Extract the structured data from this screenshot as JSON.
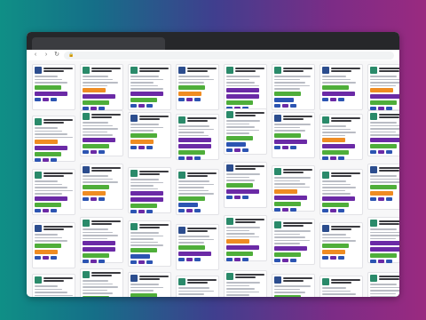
{
  "browser": {
    "tab_title": "",
    "url": ""
  },
  "board": {
    "card_text": "",
    "tag_text": ""
  },
  "colors": {
    "tag_green": "#4fae3a",
    "tag_purple": "#6b2aa6",
    "tag_orange": "#ef8c22",
    "tag_blue": "#2c54b2",
    "thumb_green": "#2a8a6a",
    "thumb_blue": "#2c4d8e"
  },
  "icons": {
    "back": "back-icon",
    "forward": "forward-icon",
    "reload": "reload-icon",
    "lock": "lock-icon"
  }
}
